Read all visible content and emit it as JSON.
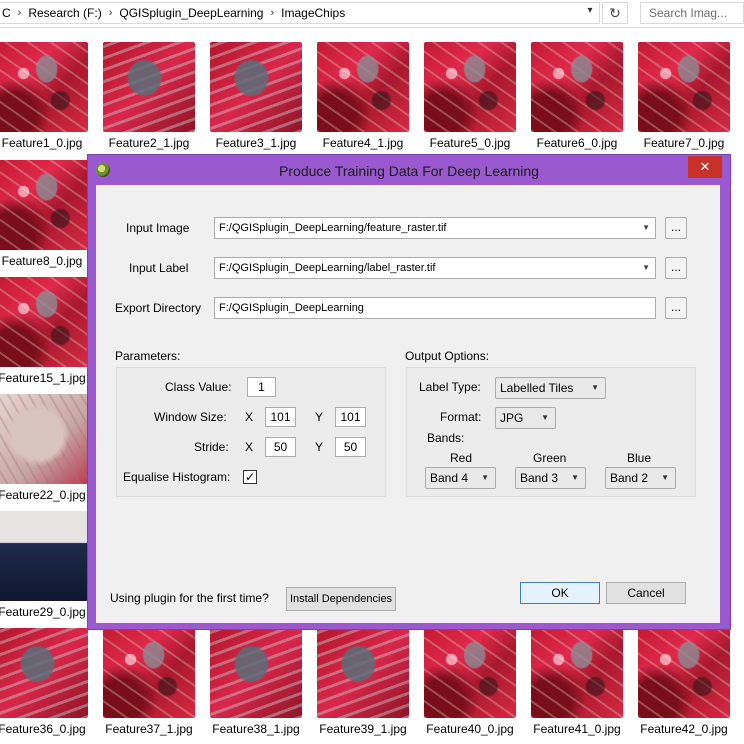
{
  "explorer": {
    "breadcrumb": [
      "C",
      "Research (F:)",
      "QGISplugin_DeepLearning",
      "ImageChips"
    ],
    "search_placeholder": "Search Imag...",
    "thumbnails": {
      "row1": [
        "Feature1_0.jpg",
        "Feature2_1.jpg",
        "Feature3_1.jpg",
        "Feature4_1.jpg",
        "Feature5_0.jpg",
        "Feature6_0.jpg",
        "Feature7_0.jpg"
      ],
      "left_column": [
        "Feature8_0.jpg",
        "Feature15_1.jpg",
        "Feature22_0.jpg",
        "Feature29_0.jpg"
      ],
      "bottom": [
        "Feature36_0.jpg",
        "Feature37_1.jpg",
        "Feature38_1.jpg",
        "Feature39_1.jpg",
        "Feature40_0.jpg",
        "Feature41_0.jpg",
        "Feature42_0.jpg"
      ]
    }
  },
  "dialog": {
    "title": "Produce Training Data For Deep Learning",
    "close_symbol": "✕",
    "input_image_label": "Input Image",
    "input_image_value": "F:/QGISplugin_DeepLearning/feature_raster.tif",
    "input_label_label": "Input Label",
    "input_label_value": "F:/QGISplugin_DeepLearning/label_raster.tif",
    "export_dir_label": "Export Directory",
    "export_dir_value": "F:/QGISplugin_DeepLearning",
    "browse_label": "...",
    "parameters": {
      "heading": "Parameters:",
      "class_value_label": "Class Value:",
      "class_value": "1",
      "window_size_label": "Window Size:",
      "window_x_label": "X",
      "window_x": "101",
      "window_y_label": "Y",
      "window_y": "101",
      "stride_label": "Stride:",
      "stride_x_label": "X",
      "stride_x": "50",
      "stride_y_label": "Y",
      "stride_y": "50",
      "equalise_label": "Equalise Histogram:",
      "equalise_checked": "✓"
    },
    "output": {
      "heading": "Output Options:",
      "label_type_label": "Label Type:",
      "label_type_value": "Labelled Tiles",
      "format_label": "Format:",
      "format_value": "JPG",
      "bands_label": "Bands:",
      "red_label": "Red",
      "red_value": "Band 4",
      "green_label": "Green",
      "green_value": "Band 3",
      "blue_label": "Blue",
      "blue_value": "Band 2"
    },
    "first_time_text": "Using plugin for the first time?",
    "install_button": "Install Dependencies",
    "ok_button": "OK",
    "cancel_button": "Cancel"
  },
  "colors": {
    "dialog_frame": "#9b59d0",
    "close_button": "#c7312a",
    "thumbnail_red": "#d62a44"
  }
}
